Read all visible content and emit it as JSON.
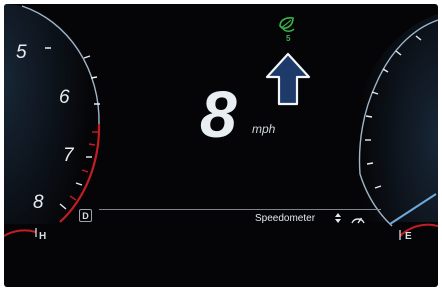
{
  "left_gauge": {
    "tick_labels": [
      "5",
      "6",
      "7",
      "8"
    ],
    "temp_high_label": "H",
    "redline_color": "#c21d23"
  },
  "right_gauge": {
    "fuel_empty_label": "E",
    "needle_color": "#6fa9d9"
  },
  "speed": {
    "value": "8",
    "unit": "mph"
  },
  "eco": {
    "icon": "eco-leaf-icon",
    "level": "5",
    "color": "#3bb54a"
  },
  "navigation": {
    "icon": "nav-arrow-up-icon",
    "color": "#1e3a6b"
  },
  "status_bar": {
    "gear": "D",
    "display_mode_label": "Speedometer",
    "toggle_icon": "up-down-icon",
    "mode_icon": "speedometer-icon"
  }
}
